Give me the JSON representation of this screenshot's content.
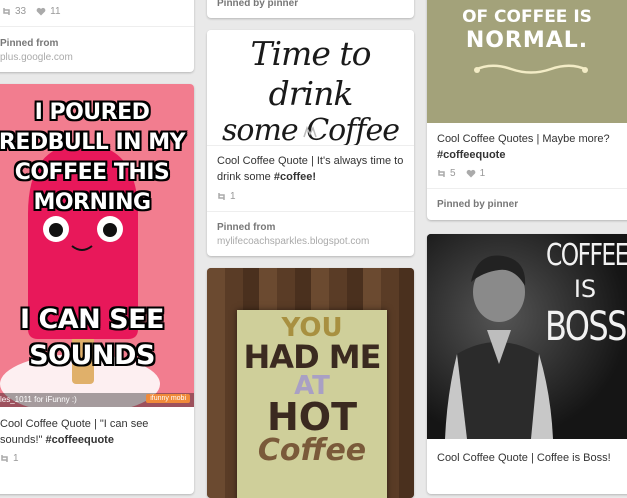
{
  "pins": {
    "pin1": {
      "repins": "33",
      "likes": "11",
      "from_label": "Pinned from",
      "from_source": "plus.google.com"
    },
    "pin2": {
      "pinned_by": "Pinned by pinner"
    },
    "pin3": {
      "image_text": [
        "OF COFFEE IS",
        "NORMAL."
      ],
      "description": "Cool Coffee Quotes | Maybe more?",
      "hashtag": "#coffeequote",
      "repins": "5",
      "likes": "1",
      "pinned_by": "Pinned by pinner"
    },
    "pin4": {
      "image_text": [
        "I POURED",
        "REDBULL IN MY",
        "COFFEE THIS",
        "MORNING",
        "I CAN SEE",
        "SOUNDS"
      ],
      "watermark_left": "les_1011 for iFunny :)",
      "watermark_right": "ifunny mobi",
      "description": "Cool Coffee Quote | \"I can see sounds!\"",
      "hashtag": "#coffeequote",
      "repins": "1"
    },
    "pin5": {
      "image_text": [
        "Time to drink",
        "some Coffee"
      ],
      "description": "Cool Coffee Quote | It's always time to drink some",
      "hashtag": "#coffee!",
      "repins": "1",
      "from_label": "Pinned from",
      "from_source": "mylifecoachsparkles.blogspot.com"
    },
    "pin6": {
      "image_text": [
        "YOU",
        "HAD ME",
        "AT",
        "HOT",
        "Coffee"
      ]
    },
    "pin7": {
      "image_text": [
        "COFFEE",
        "IS",
        "BOSS"
      ],
      "description": "Cool Coffee Quote | Coffee is Boss!"
    }
  },
  "colors": {
    "background": "#e9e9e9",
    "pink_meme": "#f27d8f",
    "olive": "#a3a27a",
    "hashtag": "#333333"
  }
}
